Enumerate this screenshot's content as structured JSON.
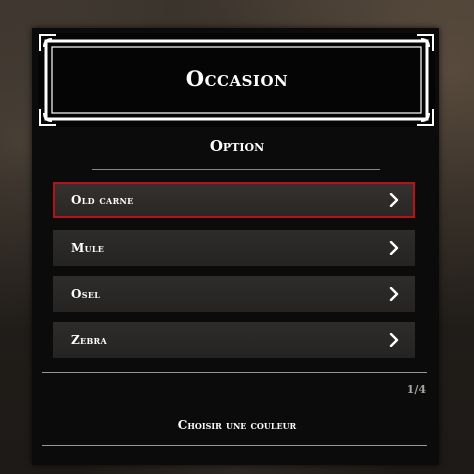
{
  "header": {
    "title": "Occasion"
  },
  "subtitle": "Option",
  "menu": {
    "items": [
      {
        "label": "Old carne",
        "selected": true
      },
      {
        "label": "Mule",
        "selected": false
      },
      {
        "label": "Osel",
        "selected": false
      },
      {
        "label": "Zebra",
        "selected": false
      }
    ]
  },
  "pagination": {
    "text": "1/4"
  },
  "footer": {
    "description": "Choisir une couleur"
  },
  "colors": {
    "accent_selected_border": "#b5121b",
    "panel_background": "#0c0b0b",
    "item_background": "#2e2c2a",
    "text": "#ffffff"
  },
  "icons": {
    "menu_item_arrow": "chevron-right-icon",
    "header_frame": "ornate-frame"
  }
}
